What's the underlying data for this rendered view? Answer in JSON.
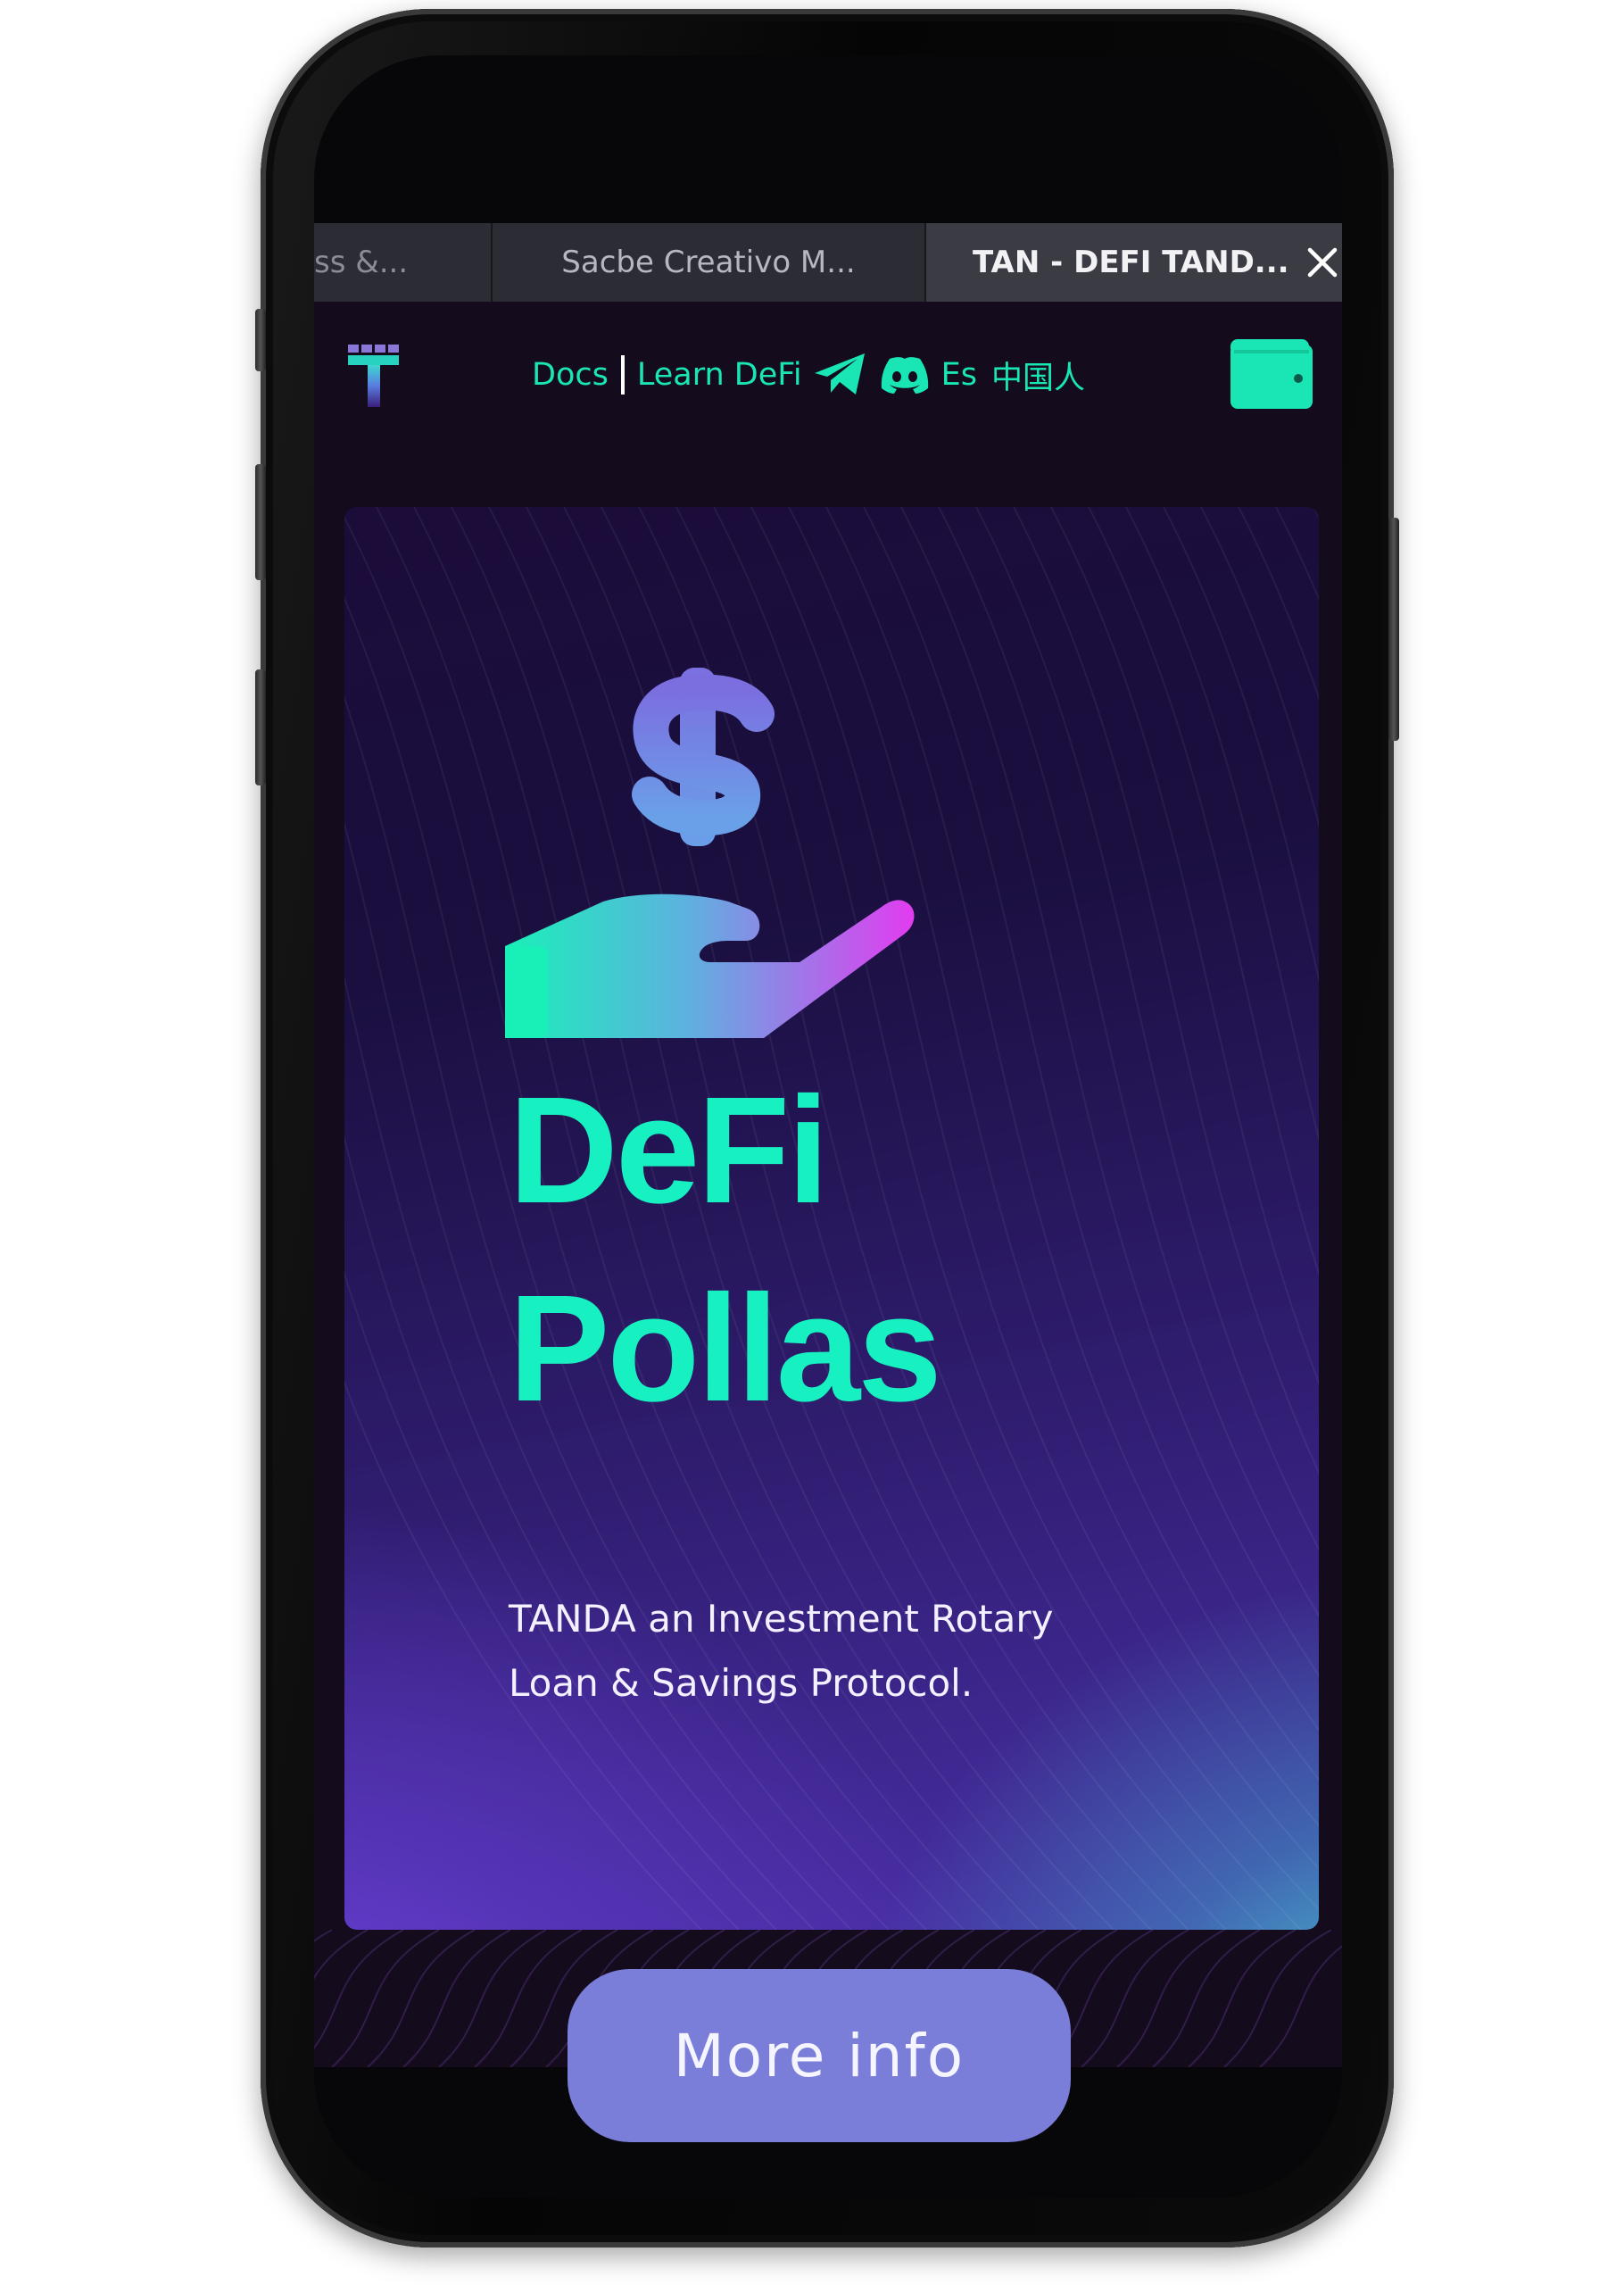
{
  "browser": {
    "tabs": [
      {
        "label": "ss &..."
      },
      {
        "label": "Sacbe Creativo M..."
      },
      {
        "label": "TAN - DEFI TAND..."
      }
    ],
    "close_icon": "close-icon"
  },
  "nav": {
    "logo_icon": "tanda-logo-icon",
    "docs": "Docs",
    "learn_defi": "Learn DeFi",
    "telegram_icon": "telegram-icon",
    "discord_icon": "discord-icon",
    "lang_es": "Es",
    "lang_zh": "中国人",
    "wallet_icon": "wallet-icon"
  },
  "hero": {
    "icon": "hand-dollar-icon",
    "title_line1": "DeFi",
    "title_line2": "Pollas",
    "subtitle_line1": "TANDA an Investment Rotary",
    "subtitle_line2": "Loan & Savings Protocol."
  },
  "cta": {
    "more_info": "More info"
  },
  "colors": {
    "accent": "#19e6b4",
    "button": "#7a7ed8",
    "background": "#140b1c"
  }
}
